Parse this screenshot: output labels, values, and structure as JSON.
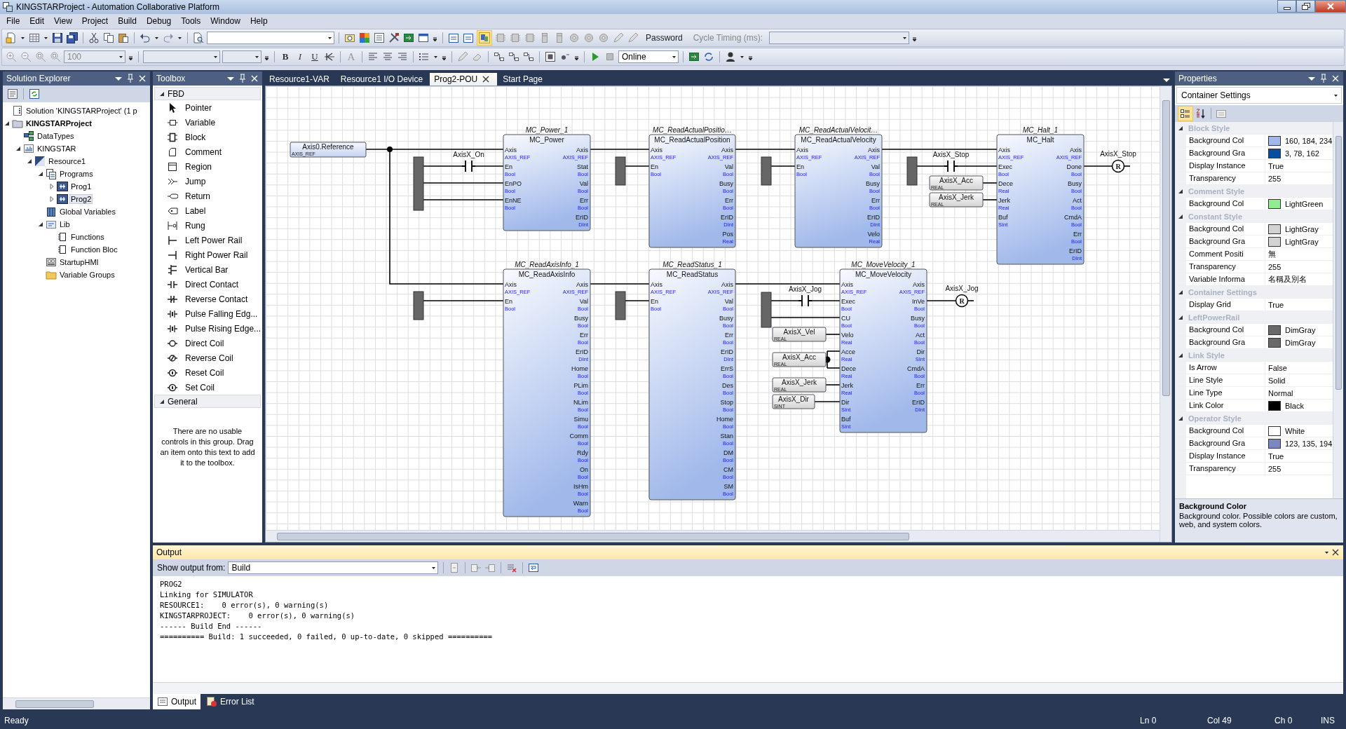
{
  "window": {
    "title": "KINGSTARProject - Automation Collaborative Platform"
  },
  "menu": [
    "File",
    "Edit",
    "View",
    "Project",
    "Build",
    "Debug",
    "Tools",
    "Window",
    "Help"
  ],
  "toolbar": {
    "password_label": "Password",
    "cycle_timing_label": "Cycle Timing (ms):",
    "zoom": "100",
    "format_buttons": [
      "B",
      "I",
      "U"
    ],
    "font_color_button": "A",
    "mode": "Online"
  },
  "solution_explorer": {
    "title": "Solution Explorer",
    "tree": [
      {
        "label": "Solution 'KINGSTARProject' (1 p",
        "kind": "solution",
        "selected": false
      },
      {
        "label": "KINGSTARProject",
        "kind": "project",
        "expanded": true,
        "selected": false,
        "children": [
          {
            "label": "DataTypes",
            "kind": "datatypes",
            "selected": false
          },
          {
            "label": "KINGSTAR",
            "kind": "device",
            "expanded": true,
            "selected": false,
            "children": [
              {
                "label": "Resource1",
                "kind": "resource",
                "expanded": true,
                "selected": false,
                "children": [
                  {
                    "label": "Programs",
                    "kind": "programs",
                    "expanded": true,
                    "selected": false,
                    "children": [
                      {
                        "label": "Prog1",
                        "kind": "program",
                        "expanded": false,
                        "selected": false
                      },
                      {
                        "label": "Prog2",
                        "kind": "program",
                        "expanded": false,
                        "selected": true
                      }
                    ]
                  },
                  {
                    "label": "Global Variables",
                    "kind": "globals",
                    "selected": false
                  },
                  {
                    "label": "Lib",
                    "kind": "lib",
                    "expanded": true,
                    "selected": false,
                    "children": [
                      {
                        "label": "Functions",
                        "kind": "functions",
                        "selected": false
                      },
                      {
                        "label": "Function Bloc",
                        "kind": "functions",
                        "selected": false
                      }
                    ]
                  },
                  {
                    "label": "StartupHMI",
                    "kind": "hmi",
                    "selected": false
                  },
                  {
                    "label": "Variable Groups",
                    "kind": "folder",
                    "selected": false
                  }
                ]
              }
            ]
          }
        ]
      }
    ]
  },
  "toolbox": {
    "title": "Toolbox",
    "groups": [
      {
        "title": "FBD",
        "expanded": true,
        "items": [
          {
            "label": "Pointer",
            "kind": "pointer"
          },
          {
            "label": "Variable",
            "kind": "variable"
          },
          {
            "label": "Block",
            "kind": "block"
          },
          {
            "label": "Comment",
            "kind": "comment"
          },
          {
            "label": "Region",
            "kind": "region"
          },
          {
            "label": "Jump",
            "kind": "jump"
          },
          {
            "label": "Return",
            "kind": "return"
          },
          {
            "label": "Label",
            "kind": "label"
          },
          {
            "label": "Rung",
            "kind": "rung"
          },
          {
            "label": "Left Power Rail",
            "kind": "left-rail"
          },
          {
            "label": "Right Power Rail",
            "kind": "right-rail"
          },
          {
            "label": "Vertical Bar",
            "kind": "vertical-bar"
          },
          {
            "label": "Direct Contact",
            "kind": "contact"
          },
          {
            "label": "Reverse Contact",
            "kind": "reverse-contact"
          },
          {
            "label": "Pulse Falling Edg...",
            "kind": "pulse-contact"
          },
          {
            "label": "Pulse Rising Edge...",
            "kind": "pulse-contact"
          },
          {
            "label": "Direct Coil",
            "kind": "coil"
          },
          {
            "label": "Reverse Coil",
            "kind": "reverse-coil"
          },
          {
            "label": "Reset Coil",
            "kind": "marked-coil"
          },
          {
            "label": "Set Coil",
            "kind": "marked-coil"
          }
        ]
      },
      {
        "title": "General",
        "expanded": true,
        "message": "There are no usable controls in this group. Drag an item onto this text to add it to the toolbox."
      }
    ]
  },
  "documents": [
    {
      "title": "Resource1-VAR",
      "selected": false
    },
    {
      "title": "Resource1 I/O Device",
      "selected": false
    },
    {
      "title": "Prog2-POU",
      "selected": true
    },
    {
      "title": "Start Page",
      "selected": false
    }
  ],
  "diagram": {
    "variables": [
      {
        "name": "Axis0.Reference",
        "type": "AXIS_REF"
      }
    ],
    "blocks": [
      {
        "instance": "MC_Power_1",
        "type": "MC_Power",
        "inputs": [
          {
            "name": "Axis",
            "type": "AXIS_REF"
          },
          {
            "name": "En",
            "type": "Bool"
          },
          {
            "name": "EnPO",
            "type": "Bool"
          },
          {
            "name": "EnNE",
            "type": "Bool"
          }
        ],
        "outputs": [
          {
            "name": "Axis",
            "type": "AXIS_REF"
          },
          {
            "name": "Stat",
            "type": "Bool"
          },
          {
            "name": "Val",
            "type": "Bool"
          },
          {
            "name": "Err",
            "type": "Bool"
          },
          {
            "name": "ErID",
            "type": "DInt"
          }
        ]
      },
      {
        "instance": "MC_ReadActualPositio…",
        "type": "MC_ReadActualPosition",
        "inputs": [
          {
            "name": "Axis",
            "type": "AXIS_REF"
          },
          {
            "name": "En",
            "type": "Bool"
          }
        ],
        "outputs": [
          {
            "name": "Axis",
            "type": "AXIS_REF"
          },
          {
            "name": "Val",
            "type": "Bool"
          },
          {
            "name": "Busy",
            "type": "Bool"
          },
          {
            "name": "Err",
            "type": "Bool"
          },
          {
            "name": "ErID",
            "type": "DInt"
          },
          {
            "name": "Pos",
            "type": "Real"
          }
        ]
      },
      {
        "instance": "MC_ReadActualVelocit…",
        "type": "MC_ReadActualVelocity",
        "inputs": [
          {
            "name": "Axis",
            "type": "AXIS_REF"
          },
          {
            "name": "En",
            "type": "Bool"
          }
        ],
        "outputs": [
          {
            "name": "Axis",
            "type": "AXIS_REF"
          },
          {
            "name": "Val",
            "type": "Bool"
          },
          {
            "name": "Busy",
            "type": "Bool"
          },
          {
            "name": "Err",
            "type": "Bool"
          },
          {
            "name": "ErID",
            "type": "DInt"
          },
          {
            "name": "Velo",
            "type": "Real"
          }
        ]
      },
      {
        "instance": "MC_Halt_1",
        "type": "MC_Halt",
        "inputs": [
          {
            "name": "Axis",
            "type": "AXIS_REF"
          },
          {
            "name": "Exec",
            "type": "Bool"
          },
          {
            "name": "Dece",
            "type": "Real"
          },
          {
            "name": "Jerk",
            "type": "Real"
          },
          {
            "name": "Buf",
            "type": "SInt"
          }
        ],
        "outputs": [
          {
            "name": "Axis",
            "type": "AXIS_REF"
          },
          {
            "name": "Done",
            "type": "Bool"
          },
          {
            "name": "Busy",
            "type": "Bool"
          },
          {
            "name": "Act",
            "type": "Bool"
          },
          {
            "name": "CmdA",
            "type": "Bool"
          },
          {
            "name": "Err",
            "type": "Bool"
          },
          {
            "name": "ErID",
            "type": "DInt"
          }
        ]
      },
      {
        "instance": "MC_ReadAxisInfo_1",
        "type": "MC_ReadAxisInfo",
        "inputs": [
          {
            "name": "Axis",
            "type": "AXIS_REF"
          },
          {
            "name": "En",
            "type": "Bool"
          }
        ],
        "outputs": [
          {
            "name": "Axis",
            "type": "AXIS_REF"
          },
          {
            "name": "Val",
            "type": "Bool"
          },
          {
            "name": "Busy",
            "type": "Bool"
          },
          {
            "name": "Err",
            "type": "Bool"
          },
          {
            "name": "ErID",
            "type": "DInt"
          },
          {
            "name": "Home",
            "type": "Bool"
          },
          {
            "name": "PLim",
            "type": "Bool"
          },
          {
            "name": "NLim",
            "type": "Bool"
          },
          {
            "name": "Simu",
            "type": "Bool"
          },
          {
            "name": "Comm",
            "type": "Bool"
          },
          {
            "name": "Rdy",
            "type": "Bool"
          },
          {
            "name": "On",
            "type": "Bool"
          },
          {
            "name": "IsHm",
            "type": "Bool"
          },
          {
            "name": "Warn",
            "type": "Bool"
          }
        ]
      },
      {
        "instance": "MC_ReadStatus_1",
        "type": "MC_ReadStatus",
        "inputs": [
          {
            "name": "Axis",
            "type": "AXIS_REF"
          },
          {
            "name": "En",
            "type": "Bool"
          }
        ],
        "outputs": [
          {
            "name": "Axis",
            "type": "AXIS_REF"
          },
          {
            "name": "Val",
            "type": "Bool"
          },
          {
            "name": "Busy",
            "type": "Bool"
          },
          {
            "name": "Err",
            "type": "Bool"
          },
          {
            "name": "ErID",
            "type": "DInt"
          },
          {
            "name": "ErrS",
            "type": "Bool"
          },
          {
            "name": "Des",
            "type": "Bool"
          },
          {
            "name": "Stop",
            "type": "Bool"
          },
          {
            "name": "Home",
            "type": "Bool"
          },
          {
            "name": "Stan",
            "type": "Bool"
          },
          {
            "name": "DM",
            "type": "Bool"
          },
          {
            "name": "CM",
            "type": "Bool"
          },
          {
            "name": "SM",
            "type": "Bool"
          }
        ]
      },
      {
        "instance": "MC_MoveVelocity_1",
        "type": "MC_MoveVelocity",
        "inputs": [
          {
            "name": "Axis",
            "type": "AXIS_REF"
          },
          {
            "name": "Exec",
            "type": "Bool"
          },
          {
            "name": "CU",
            "type": "Bool"
          },
          {
            "name": "Velo",
            "type": "Real"
          },
          {
            "name": "Acce",
            "type": "Real"
          },
          {
            "name": "Dece",
            "type": "Real"
          },
          {
            "name": "Jerk",
            "type": "Real"
          },
          {
            "name": "Dir",
            "type": "SInt"
          },
          {
            "name": "Buf",
            "type": "SInt"
          }
        ],
        "outputs": [
          {
            "name": "Axis",
            "type": "AXIS_REF"
          },
          {
            "name": "InVe",
            "type": "Bool"
          },
          {
            "name": "Busy",
            "type": "Bool"
          },
          {
            "name": "Act",
            "type": "Bool"
          },
          {
            "name": "Dir",
            "type": "SInt"
          },
          {
            "name": "CmdA",
            "type": "Bool"
          },
          {
            "name": "Err",
            "type": "Bool"
          },
          {
            "name": "ErID",
            "type": "DInt"
          }
        ]
      }
    ],
    "contacts": [
      {
        "name": "AxisX_On"
      },
      {
        "name": "AxisX_Stop"
      },
      {
        "name": "AxisX_Jog"
      }
    ],
    "constants": [
      {
        "name": "AxisX_Acc",
        "type": "REAL"
      },
      {
        "name": "AxisX_Jerk",
        "type": "REAL"
      },
      {
        "name": "AxisX_Vel",
        "type": "REAL"
      },
      {
        "name": "AxisX_Acc",
        "type": "REAL"
      },
      {
        "name": "AxisX_Jerk",
        "type": "REAL"
      },
      {
        "name": "AxisX_Dir",
        "type": "SINT"
      }
    ],
    "coils": [
      {
        "name": "AxisX_Stop",
        "symbol": "R"
      },
      {
        "name": "AxisX_Jog",
        "symbol": "R"
      }
    ]
  },
  "properties": {
    "title": "Properties",
    "object": "Container Settings",
    "groups": [
      {
        "title": "Block Style",
        "expanded": true,
        "rows": [
          {
            "name": "Background Col",
            "value": "160, 184, 234",
            "color": "#a0b8ea"
          },
          {
            "name": "Background Gra",
            "value": "3, 78, 162",
            "color": "#034ea2"
          },
          {
            "name": "Display Instance",
            "value": "True"
          },
          {
            "name": "Transparency",
            "value": "255"
          }
        ]
      },
      {
        "title": "Comment Style",
        "expanded": true,
        "rows": [
          {
            "name": "Background Col",
            "value": "LightGreen",
            "color": "#90ee90"
          }
        ]
      },
      {
        "title": "Constant Style",
        "expanded": true,
        "rows": [
          {
            "name": "Background Col",
            "value": "LightGray",
            "color": "#d3d3d3"
          },
          {
            "name": "Background Gra",
            "value": "LightGray",
            "color": "#d3d3d3"
          },
          {
            "name": "Comment Positi",
            "value": "無"
          },
          {
            "name": "Transparency",
            "value": "255"
          },
          {
            "name": "Variable Informa",
            "value": "名稱及別名"
          }
        ]
      },
      {
        "title": "Container Settings",
        "expanded": true,
        "rows": [
          {
            "name": "Display Grid",
            "value": "True"
          }
        ]
      },
      {
        "title": "LeftPowerRail",
        "expanded": true,
        "rows": [
          {
            "name": "Background Col",
            "value": "DimGray",
            "color": "#696969"
          },
          {
            "name": "Background Gra",
            "value": "DimGray",
            "color": "#696969"
          }
        ]
      },
      {
        "title": "Link Style",
        "expanded": true,
        "rows": [
          {
            "name": "Is Arrow",
            "value": "False"
          },
          {
            "name": "Line Style",
            "value": "Solid"
          },
          {
            "name": "Line Type",
            "value": "Normal"
          },
          {
            "name": "Link Color",
            "value": "Black",
            "color": "#000000"
          }
        ]
      },
      {
        "title": "Operator Style",
        "expanded": true,
        "rows": [
          {
            "name": "Background Col",
            "value": "White",
            "color": "#ffffff"
          },
          {
            "name": "Background Gra",
            "value": "123, 135, 194",
            "color": "#7b87c2"
          },
          {
            "name": "Display Instance",
            "value": "True"
          },
          {
            "name": "Transparency",
            "value": "255"
          }
        ]
      }
    ],
    "description_title": "Background Color",
    "description": "Background color. Possible colors are custom, web, and system colors."
  },
  "output": {
    "title": "Output",
    "source_label": "Show output from:",
    "source": "Build",
    "lines": [
      "PROG2",
      "Linking for SIMULATOR",
      "RESOURCE1:    0 error(s), 0 warning(s)",
      "KINGSTARPROJECT:    0 error(s), 0 warning(s)",
      "------ Build End ------",
      "========== Build: 1 succeeded, 0 failed, 0 up-to-date, 0 skipped =========="
    ],
    "tabs": [
      {
        "label": "Output",
        "selected": true
      },
      {
        "label": "Error List",
        "selected": false
      }
    ]
  },
  "status_bar": {
    "message": "Ready",
    "line": "Ln 0",
    "column": "Col 49",
    "char": "Ch 0",
    "mode": "INS"
  }
}
